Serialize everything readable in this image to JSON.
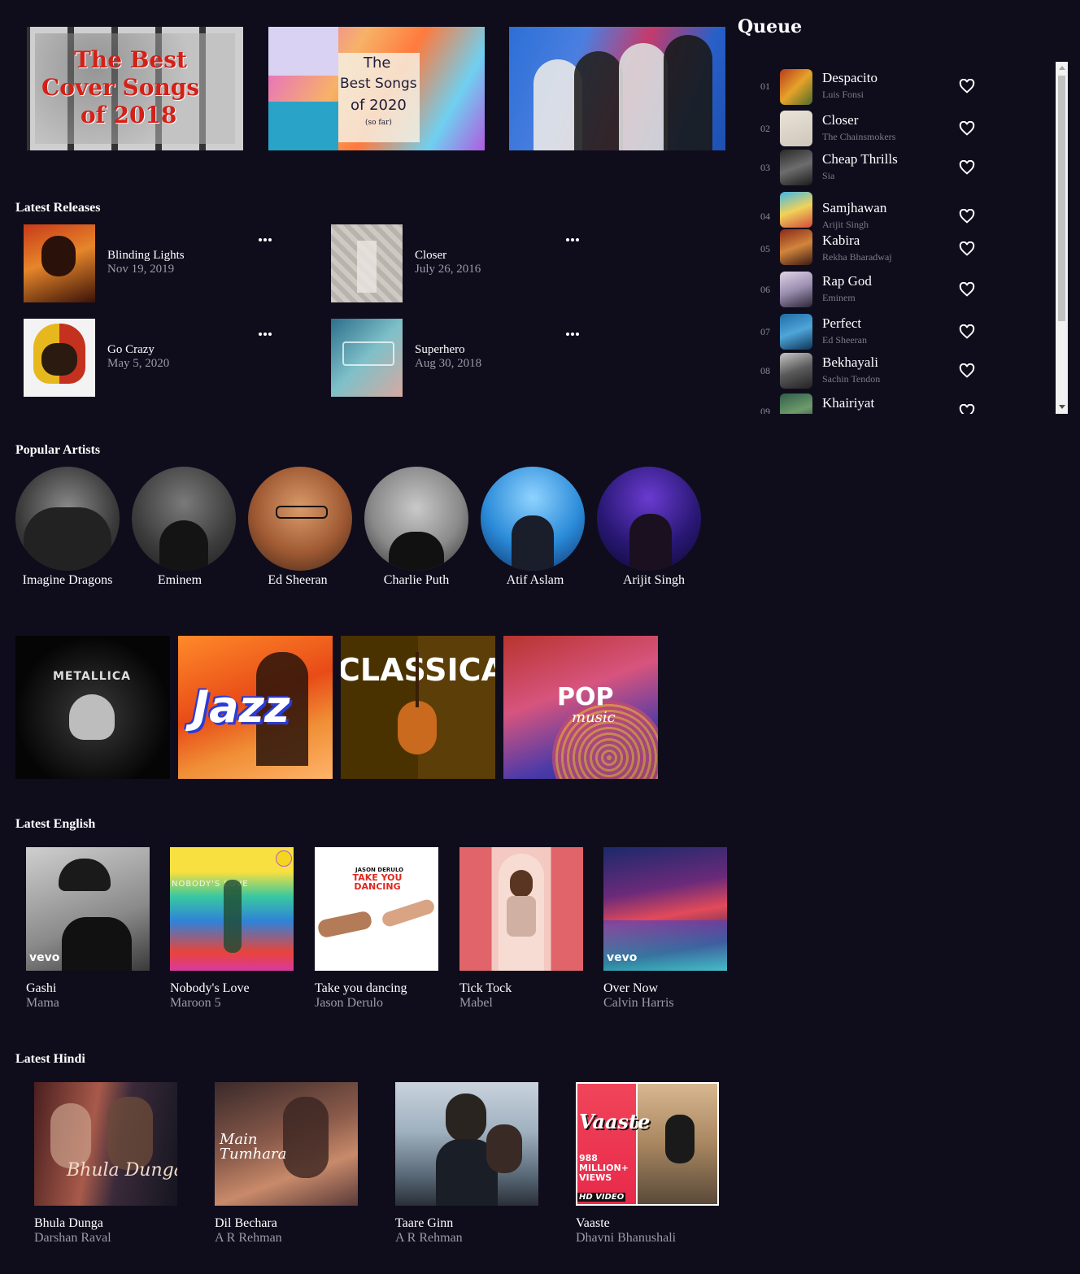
{
  "banners": [
    {
      "lines": [
        "The Best",
        "Cover Songs",
        "of 2018"
      ]
    },
    {
      "lines": [
        "The",
        "Best Songs",
        "of 2020",
        "(so far)"
      ]
    },
    {
      "lines": []
    }
  ],
  "queue": {
    "title": "Queue",
    "items": [
      {
        "num": "01",
        "title": "Despacito",
        "artist": "Luis Fonsi"
      },
      {
        "num": "02",
        "title": "Closer",
        "artist": "The Chainsmokers"
      },
      {
        "num": "03",
        "title": "Cheap Thrills",
        "artist": "Sia"
      },
      {
        "num": "04",
        "title": "Samjhawan",
        "artist": "Arijit Singh"
      },
      {
        "num": "05",
        "title": "Kabira",
        "artist": "Rekha Bharadwaj"
      },
      {
        "num": "06",
        "title": "Rap God",
        "artist": "Eminem"
      },
      {
        "num": "07",
        "title": "Perfect",
        "artist": "Ed Sheeran"
      },
      {
        "num": "08",
        "title": "Bekhayali",
        "artist": "Sachin Tendon"
      },
      {
        "num": "09",
        "title": "Khairiyat",
        "artist": ""
      }
    ]
  },
  "latest_releases": {
    "title": "Latest Releases",
    "items": [
      {
        "title": "Blinding Lights",
        "date": "Nov 19, 2019"
      },
      {
        "title": "Closer",
        "date": "July 26, 2016"
      },
      {
        "title": "Go Crazy",
        "date": "May 5, 2020"
      },
      {
        "title": "Superhero",
        "date": "Aug 30, 2018"
      }
    ]
  },
  "popular_artists": {
    "title": "Popular Artists",
    "items": [
      "Imagine Dragons",
      "Eminem",
      "Ed Sheeran",
      "Charlie Puth",
      "Atif Aslam",
      "Arijit Singh"
    ]
  },
  "genres": [
    {
      "name": "METALLICA"
    },
    {
      "name": "Jazz"
    },
    {
      "name": "CLASSICA"
    },
    {
      "name": "POP",
      "sub": "music"
    }
  ],
  "latest_english": {
    "title": "Latest English",
    "items": [
      {
        "title": "Gashi",
        "artist": "Mama"
      },
      {
        "title": "Nobody's Love",
        "artist": "Maroon 5"
      },
      {
        "title": "Take you dancing",
        "artist": "Jason Derulo"
      },
      {
        "title": "Tick Tock",
        "artist": "Mabel"
      },
      {
        "title": "Over Now",
        "artist": "Calvin Harris"
      }
    ],
    "art_text": {
      "nobody": "NOBODY'S LOVE",
      "take1": "JASON DERULO",
      "take2": "TAKE YOU DANCING",
      "vevo": "vevo"
    }
  },
  "latest_hindi": {
    "title": "Latest Hindi",
    "items": [
      {
        "title": "Bhula Dunga",
        "artist": "Darshan Raval"
      },
      {
        "title": "Dil Bechara",
        "artist": "A R Rehman"
      },
      {
        "title": "Taare Ginn",
        "artist": "A R Rehman"
      },
      {
        "title": "Vaaste",
        "artist": "Dhavni Bhanushali"
      }
    ],
    "art_text": {
      "bhula": "Bhula Dunga",
      "main": "Main Tumhara",
      "vaaste": "Vaaste",
      "views": "988 MILLION+ VIEWS",
      "hd": "HD VIDEO"
    }
  },
  "colors": {
    "background": "#0f0d1c",
    "muted_text": "#9c9aa6"
  }
}
